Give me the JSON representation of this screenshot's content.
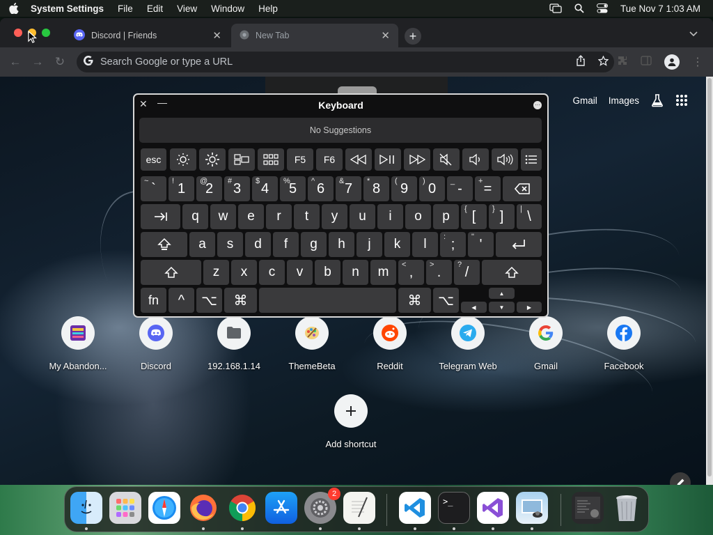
{
  "menubar": {
    "app_name": "System Settings",
    "items": [
      "File",
      "Edit",
      "View",
      "Window",
      "Help"
    ],
    "clock": "Tue Nov 7  1:03 AM"
  },
  "browser": {
    "tabs": [
      {
        "title": "Discord | Friends",
        "icon": "discord-icon"
      },
      {
        "title": "New Tab",
        "icon": "chrome-icon"
      }
    ],
    "omnibox_placeholder": "Search Google or type a URL",
    "top_links": {
      "gmail": "Gmail",
      "images": "Images"
    }
  },
  "shortcuts": [
    {
      "label": "My Abandon...",
      "icon": "abandonware-icon"
    },
    {
      "label": "Discord",
      "icon": "discord-icon"
    },
    {
      "label": "192.168.1.14",
      "icon": "folder-icon"
    },
    {
      "label": "ThemeBeta",
      "icon": "themebeta-icon"
    },
    {
      "label": "Reddit",
      "icon": "reddit-icon"
    },
    {
      "label": "Telegram Web",
      "icon": "telegram-icon"
    },
    {
      "label": "Gmail",
      "icon": "google-icon"
    },
    {
      "label": "Facebook",
      "icon": "facebook-icon"
    }
  ],
  "add_shortcut_label": "Add shortcut",
  "keyboard": {
    "title": "Keyboard",
    "suggestions": "No Suggestions",
    "fkeys": {
      "esc": "esc",
      "f5": "F5",
      "f6": "F6"
    },
    "number_row": [
      {
        "sub": "~",
        "main": "`"
      },
      {
        "sub": "!",
        "main": "1"
      },
      {
        "sub": "@",
        "main": "2"
      },
      {
        "sub": "#",
        "main": "3"
      },
      {
        "sub": "$",
        "main": "4"
      },
      {
        "sub": "%",
        "main": "5"
      },
      {
        "sub": "^",
        "main": "6"
      },
      {
        "sub": "&",
        "main": "7"
      },
      {
        "sub": "*",
        "main": "8"
      },
      {
        "sub": "(",
        "main": "9"
      },
      {
        "sub": ")",
        "main": "0"
      },
      {
        "sub": "_",
        "main": "-"
      },
      {
        "sub": "+",
        "main": "="
      }
    ],
    "top_row": [
      "q",
      "w",
      "e",
      "r",
      "t",
      "y",
      "u",
      "i",
      "o",
      "p"
    ],
    "top_row_extra": [
      {
        "sub": "{",
        "main": "["
      },
      {
        "sub": "}",
        "main": "]"
      },
      {
        "sub": "|",
        "main": "\\"
      }
    ],
    "home_row": [
      "a",
      "s",
      "d",
      "f",
      "g",
      "h",
      "j",
      "k",
      "l"
    ],
    "home_row_extra": [
      {
        "sub": ":",
        "main": ";"
      },
      {
        "sub": "\"",
        "main": "'"
      }
    ],
    "bottom_row": [
      "z",
      "x",
      "c",
      "v",
      "b",
      "n",
      "m"
    ],
    "bottom_row_extra": [
      {
        "sub": "<",
        "main": ","
      },
      {
        "sub": ">",
        "main": "."
      },
      {
        "sub": "?",
        "main": "/"
      }
    ],
    "mod_labels": {
      "fn": "fn",
      "ctrl": "^",
      "option": "⌥",
      "command": "⌘"
    }
  },
  "dock": {
    "apps": [
      "finder-icon",
      "launchpad-icon",
      "safari-icon",
      "firefox-icon",
      "chrome-icon",
      "app-store-icon",
      "system-settings-icon",
      "textedit-icon",
      "vscode-icon",
      "terminal-icon",
      "visual-studio-icon",
      "preview-icon",
      "recent-window-icon",
      "trash-icon"
    ],
    "settings_badge": "2"
  }
}
